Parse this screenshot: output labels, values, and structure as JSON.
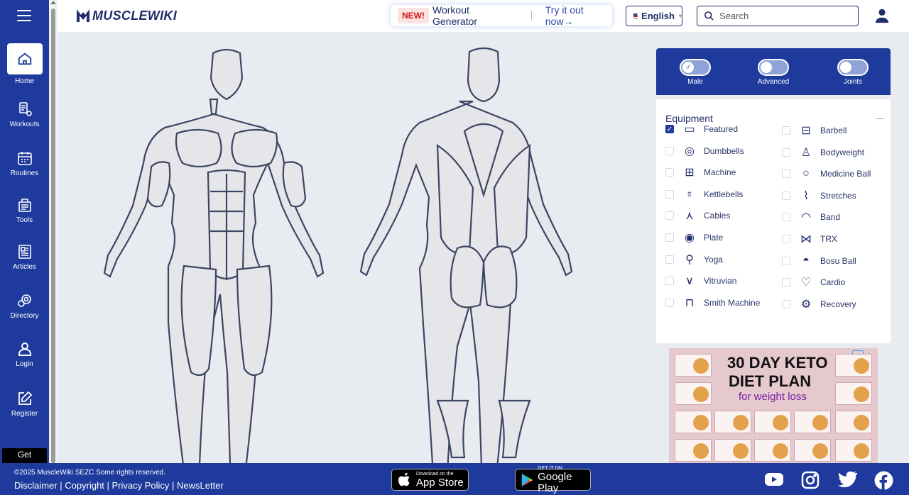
{
  "sidebar": {
    "items": [
      {
        "label": "Home",
        "icon": "home-icon"
      },
      {
        "label": "Workouts",
        "icon": "workouts-icon"
      },
      {
        "label": "Routines",
        "icon": "calendar-icon"
      },
      {
        "label": "Tools",
        "icon": "tools-icon"
      },
      {
        "label": "Articles",
        "icon": "articles-icon"
      },
      {
        "label": "Directory",
        "icon": "directory-icon"
      },
      {
        "label": "Login",
        "icon": "user-icon"
      },
      {
        "label": "Register",
        "icon": "edit-icon"
      }
    ],
    "get_label": "Get"
  },
  "header": {
    "logo": "MUSCLEWIKI",
    "promo_badge": "NEW!",
    "promo_text": "Workout Generator",
    "promo_link": "Try it out now",
    "promo_arrow": "→",
    "language": "English",
    "search_placeholder": "Search"
  },
  "toggles": [
    {
      "label": "Male",
      "symbol": "♂"
    },
    {
      "label": "Advanced",
      "symbol": ""
    },
    {
      "label": "Joints",
      "symbol": ""
    }
  ],
  "equipment": {
    "title": "Equipment",
    "items": [
      {
        "label": "Featured",
        "checked": true
      },
      {
        "label": "Barbell",
        "checked": false
      },
      {
        "label": "Dumbbells",
        "checked": false
      },
      {
        "label": "Bodyweight",
        "checked": false
      },
      {
        "label": "Machine",
        "checked": false
      },
      {
        "label": "Medicine Ball",
        "checked": false
      },
      {
        "label": "Kettlebells",
        "checked": false
      },
      {
        "label": "Stretches",
        "checked": false
      },
      {
        "label": "Cables",
        "checked": false
      },
      {
        "label": "Band",
        "checked": false
      },
      {
        "label": "Plate",
        "checked": false
      },
      {
        "label": "TRX",
        "checked": false
      },
      {
        "label": "Yoga",
        "checked": false
      },
      {
        "label": "Bosu Ball",
        "checked": false
      },
      {
        "label": "Vitruvian",
        "checked": false
      },
      {
        "label": "Cardio",
        "checked": false
      },
      {
        "label": "Smith Machine",
        "checked": false
      },
      {
        "label": "Recovery",
        "checked": false
      }
    ]
  },
  "ad": {
    "line1": "30 DAY KETO",
    "line2": "DIET PLAN",
    "line3": "for weight loss"
  },
  "footer": {
    "copyright": "©2025 MuscleWiki SEZC Some rights reserved.",
    "links": "Disclaimer | Copyright | Privacy Policy | NewsLetter",
    "appstore_small": "Download on the",
    "appstore_big": "App Store",
    "gplay_small": "GET IT ON",
    "gplay_big": "Google Play"
  },
  "colors": {
    "brand": "#1e3a9c",
    "background": "#e8ebef"
  }
}
